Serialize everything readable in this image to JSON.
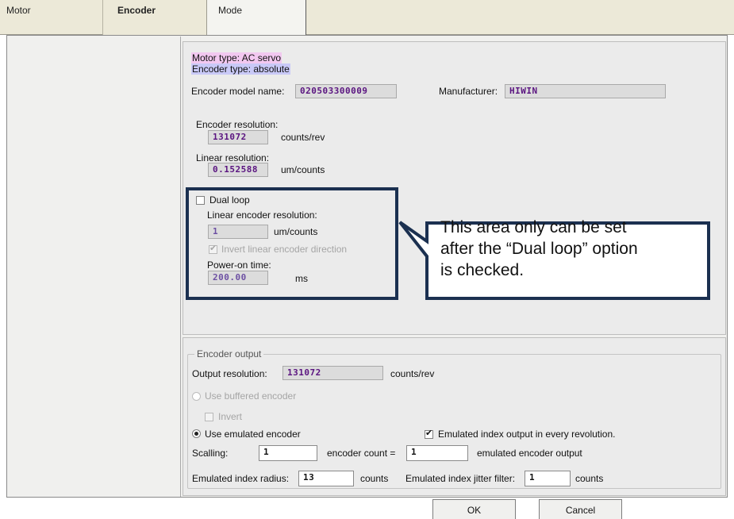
{
  "tabs": [
    {
      "label": "Motor"
    },
    {
      "label": "Encoder"
    },
    {
      "label": "Mode"
    }
  ],
  "motor_type": "Motor type: AC servo",
  "encoder_type": "Encoder type: absolute",
  "encoder_model": {
    "label": "Encoder model name:",
    "value": "020503300009"
  },
  "manufacturer": {
    "label": "Manufacturer:",
    "value": "HIWIN"
  },
  "encoder_resolution": {
    "label": "Encoder resolution:",
    "value": "131072",
    "unit": "counts/rev"
  },
  "linear_resolution": {
    "label": "Linear resolution:",
    "value": "0.152588",
    "unit": "um/counts"
  },
  "dual_loop": {
    "checkbox_label": "Dual loop",
    "checked": false,
    "linear_encoder_resolution_label": "Linear encoder resolution:",
    "linear_encoder_resolution_value": "1",
    "linear_encoder_resolution_unit": "um/counts",
    "invert_label": "Invert linear encoder direction",
    "power_on_label": "Power-on time:",
    "power_on_value": "200.00",
    "power_on_unit": "ms"
  },
  "callout": {
    "line1": "This area only can be set",
    "line2": "after the “Dual loop” option",
    "line3": "is checked."
  },
  "encoder_output": {
    "group_title": "Encoder output",
    "output_resolution_label": "Output resolution:",
    "output_resolution_value": "131072",
    "output_resolution_unit": "counts/rev",
    "use_buffered_label": "Use buffered encoder",
    "invert_label": "Invert",
    "use_emulated_label": "Use emulated encoder",
    "emulated_index_label": "Emulated index output in every revolution.",
    "emulated_index_checked": true,
    "scalling_label": "Scalling:",
    "scalling_value": "1",
    "encoder_count_label": "encoder count =",
    "encoder_count_value": "1",
    "emulated_output_label": "emulated encoder output",
    "index_radius_label": "Emulated index radius:",
    "index_radius_value": "13",
    "index_radius_unit": "counts",
    "jitter_label": "Emulated index jitter filter:",
    "jitter_value": "1",
    "jitter_unit": "counts"
  },
  "buttons": {
    "ok": "OK",
    "cancel": "Cancel"
  }
}
